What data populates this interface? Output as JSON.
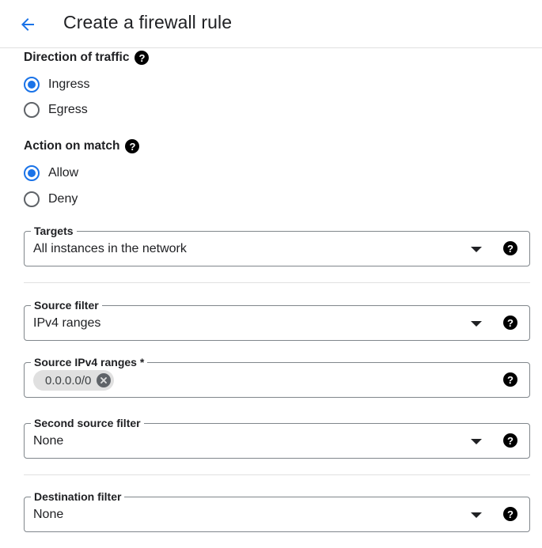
{
  "header": {
    "title": "Create a firewall rule"
  },
  "direction": {
    "label": "Direction of traffic",
    "options": [
      {
        "label": "Ingress",
        "checked": true
      },
      {
        "label": "Egress",
        "checked": false
      }
    ]
  },
  "action": {
    "label": "Action on match",
    "options": [
      {
        "label": "Allow",
        "checked": true
      },
      {
        "label": "Deny",
        "checked": false
      }
    ]
  },
  "targets": {
    "label": "Targets",
    "value": "All instances in the network"
  },
  "source_filter": {
    "label": "Source filter",
    "value": "IPv4 ranges"
  },
  "source_ipv4_ranges": {
    "label": "Source IPv4 ranges *",
    "chips": [
      "0.0.0.0/0"
    ]
  },
  "second_source_filter": {
    "label": "Second source filter",
    "value": "None"
  },
  "destination_filter": {
    "label": "Destination filter",
    "value": "None"
  },
  "colors": {
    "accent": "#1a73e8",
    "text": "#202124",
    "border": "#80868b",
    "divider": "#e0e0e0"
  },
  "help_glyph": "?"
}
